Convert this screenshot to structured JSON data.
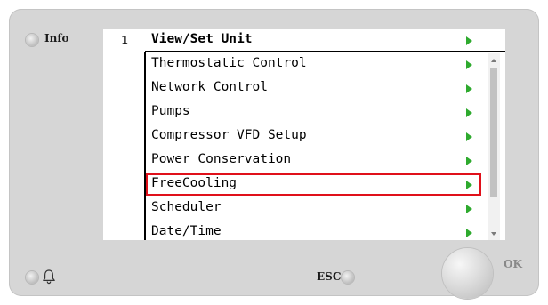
{
  "panel": {
    "info_label": "Info",
    "esc_label": "ESC",
    "ok_label": "OK"
  },
  "screen": {
    "page_number": "1",
    "header": "View/Set Unit",
    "items": [
      {
        "label": "Thermostatic Control"
      },
      {
        "label": "Network Control"
      },
      {
        "label": "Pumps"
      },
      {
        "label": "Compressor VFD Setup"
      },
      {
        "label": "Power Conservation"
      },
      {
        "label": "FreeCooling",
        "selected": true
      },
      {
        "label": "Scheduler"
      },
      {
        "label": "Date/Time"
      }
    ]
  },
  "colors": {
    "arrow": "#2eaa2e",
    "selection": "#e0101a",
    "bezel": "#d6d6d6"
  },
  "icons": {
    "row_arrow": "triangle-right-icon",
    "alarm": "bell-icon",
    "scroll_up": "chevron-up-icon",
    "scroll_down": "chevron-down-icon"
  }
}
